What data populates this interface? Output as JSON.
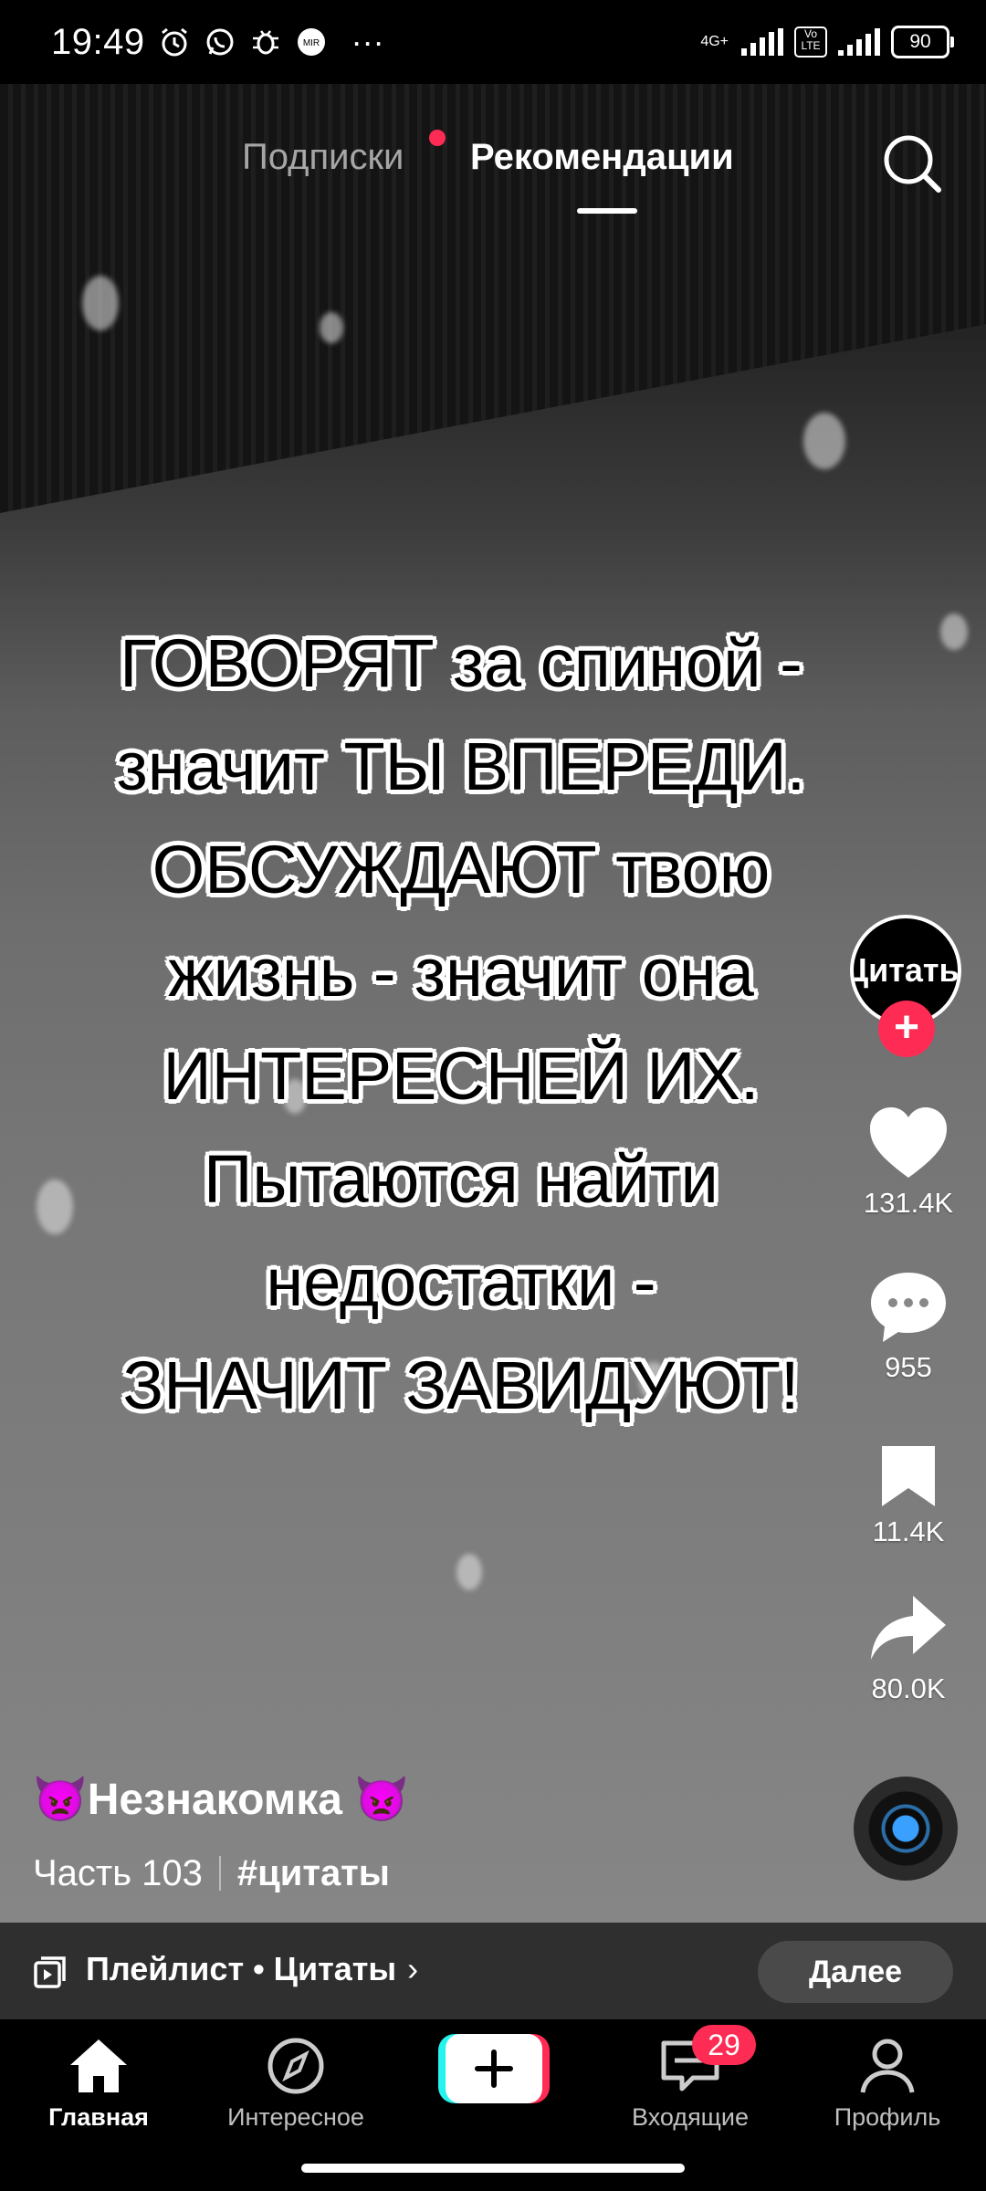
{
  "status_bar": {
    "time": "19:49",
    "network": "4G+",
    "volte": "Vo LTE",
    "battery": "90",
    "more": "···"
  },
  "top_tabs": {
    "following": "Подписки",
    "for_you": "Рекомендации",
    "active": "for_you"
  },
  "video": {
    "caption_lines": [
      "ГОВОРЯТ за спиной -",
      "значит ТЫ ВПЕРЕДИ.",
      "ОБСУЖДАЮТ твою",
      "жизнь - значит она",
      "ИНТЕРЕСНЕЙ ИХ.",
      "Пытаются найти",
      "недостатки -",
      "ЗНАЧИТ ЗАВИДУЮТ!"
    ],
    "author": "👿Незнакомка 👿",
    "part": "Часть 103",
    "hashtag": "#цитаты"
  },
  "actions": {
    "avatar_text": "Цитаты",
    "likes": "131.4K",
    "comments": "955",
    "saves": "11.4K",
    "shares": "80.0K"
  },
  "playlist": {
    "label": "Плейлист • Цитаты",
    "button": "Далее"
  },
  "bottom_nav": {
    "home": "Главная",
    "discover": "Интересное",
    "inbox": "Входящие",
    "inbox_badge": "29",
    "profile": "Профиль"
  },
  "colors": {
    "accent": "#fe2c55",
    "cyan": "#25f4ee"
  }
}
